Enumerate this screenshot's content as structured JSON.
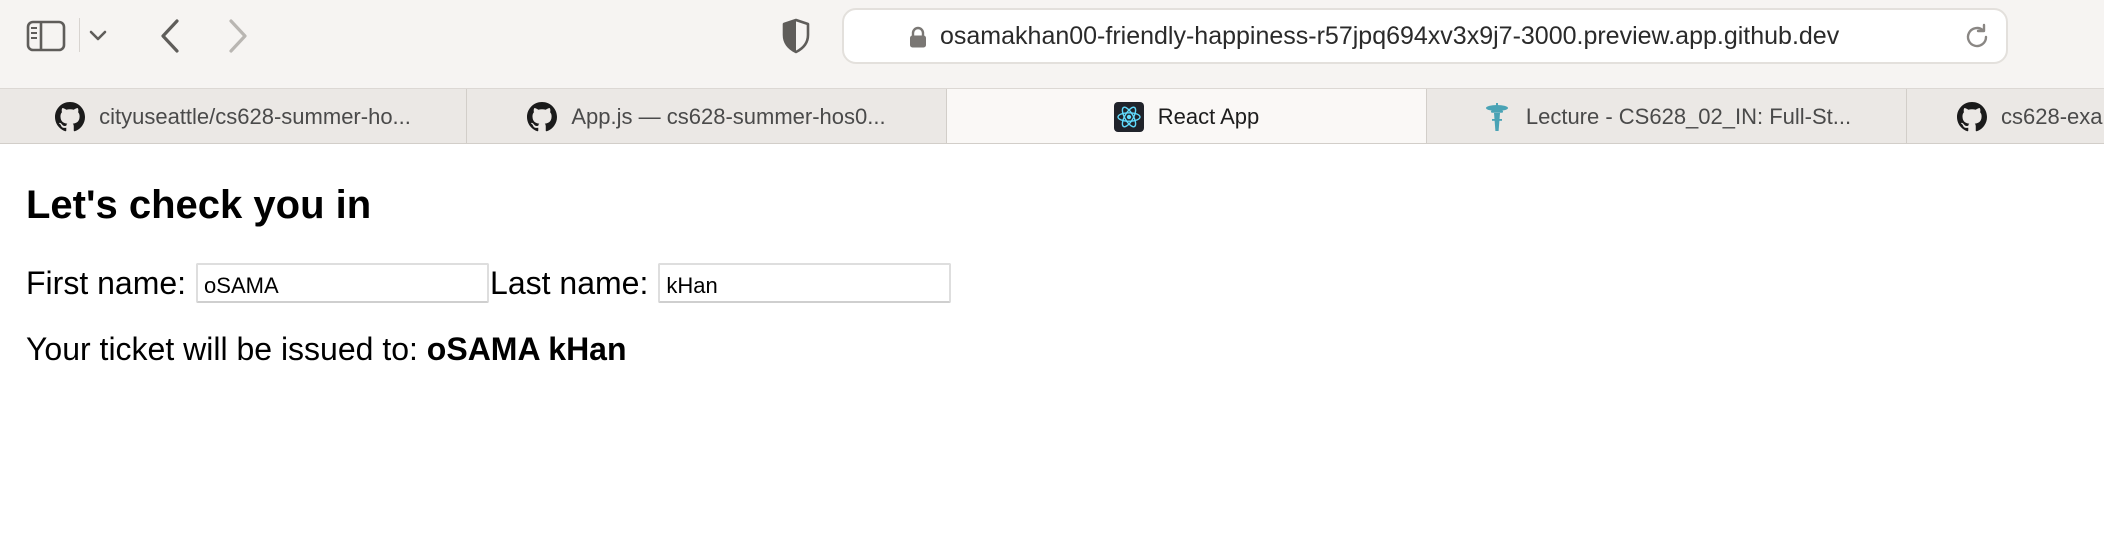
{
  "browser": {
    "url": "osamakhan00-friendly-happiness-r57jpq694xv3x9j7-3000.preview.app.github.dev",
    "icons": {
      "sidebar": "sidebar-icon",
      "chevron": "chevron-down-icon",
      "back": "back-arrow-icon",
      "forward": "forward-arrow-icon",
      "privacy": "shield-icon",
      "lock": "lock-icon",
      "reload": "reload-icon"
    }
  },
  "tabs": [
    {
      "title": "cityuseattle/cs628-summer-ho...",
      "icon": "github-icon",
      "active": false
    },
    {
      "title": "App.js — cs628-summer-hos0...",
      "icon": "github-icon",
      "active": false
    },
    {
      "title": "React App",
      "icon": "react-icon",
      "active": true
    },
    {
      "title": "Lecture - CS628_02_IN: Full-St...",
      "icon": "space-needle-icon",
      "active": false
    },
    {
      "title": "cs628-exa",
      "icon": "github-icon",
      "active": false
    }
  ],
  "page": {
    "heading": "Let's check you in",
    "first_name_label": "First name:",
    "first_name_value": "oSAMA",
    "last_name_label": "Last name:",
    "last_name_value": "kHan",
    "ticket_prefix": "Your ticket will be issued to:",
    "ticket_name": "oSAMA kHan"
  }
}
